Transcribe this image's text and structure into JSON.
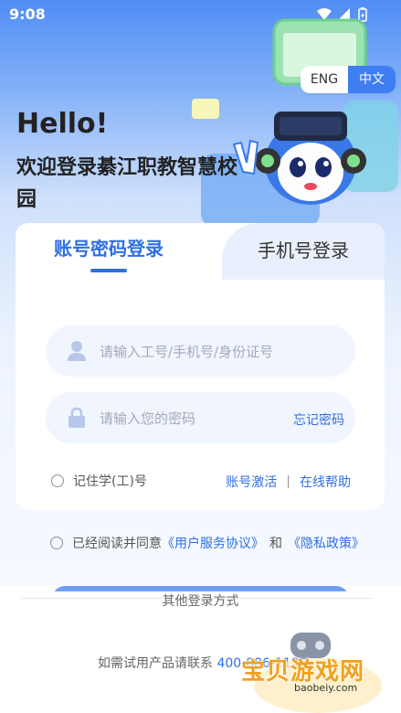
{
  "status_bar": {
    "time": "9:08"
  },
  "language": {
    "english": "ENG",
    "chinese": "中文"
  },
  "greeting": {
    "hello": "Hello!",
    "welcome": "欢迎登录綦江职教智慧校园"
  },
  "tabs": {
    "account_login": "账号密码登录",
    "phone_login": "手机号登录"
  },
  "form": {
    "account_placeholder": "请输入工号/手机号/身份证号",
    "password_placeholder": "请输入您的密码",
    "forgot_password": "忘记密码",
    "remember": "记住学(工)号",
    "activate": "账号激活",
    "separator": "|",
    "online_help": "在线帮助"
  },
  "agreement": {
    "prefix": "已经阅读并同意",
    "user_agreement": "《用户服务协议》",
    "and": "和",
    "privacy": "《隐私政策》"
  },
  "footer": {
    "other_login": "其他登录方式",
    "trial_prefix": "如需试用产品请联系",
    "trial_phone": "400-886-1129"
  },
  "watermark": {
    "text": "宝贝游戏网",
    "url": "baobeiy.com"
  },
  "colors": {
    "accent": "#2f6fe4",
    "lang_active": "#3e7ef2",
    "input_bg": "#f0f5fe"
  }
}
